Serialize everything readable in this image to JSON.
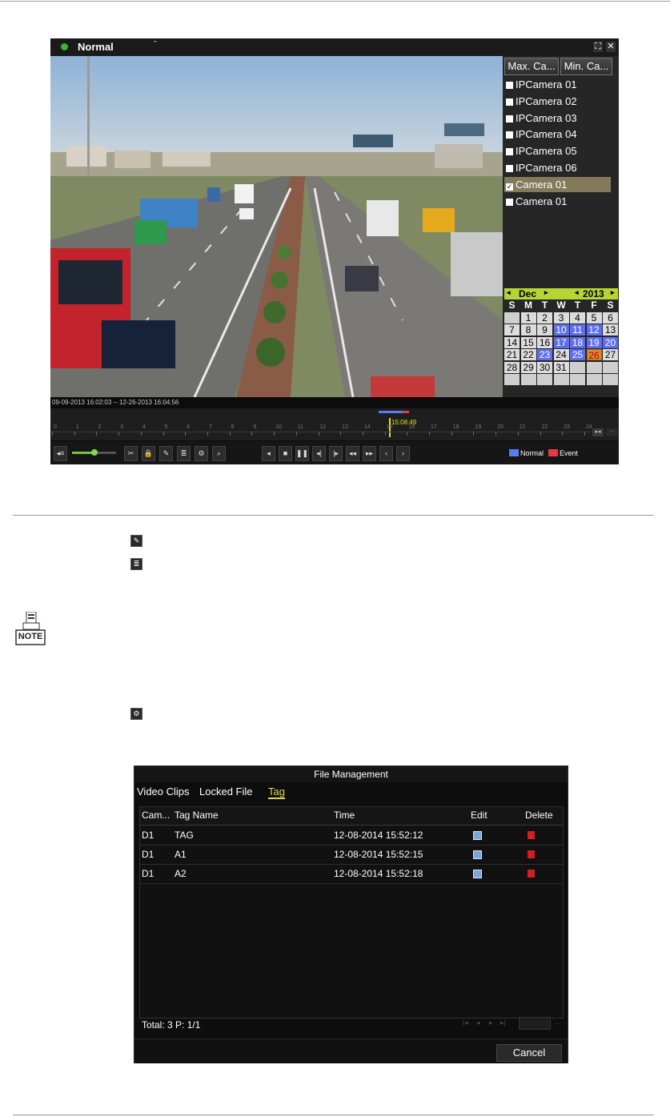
{
  "playback": {
    "mode": "Normal",
    "max_button": "Max. Ca...",
    "min_button": "Min. Ca...",
    "cameras": [
      {
        "label": "IPCamera 01",
        "checked": false
      },
      {
        "label": "IPCamera 02",
        "checked": false
      },
      {
        "label": "IPCamera 03",
        "checked": false
      },
      {
        "label": "IPCamera 04",
        "checked": false
      },
      {
        "label": "IPCamera 05",
        "checked": false
      },
      {
        "label": "IPCamera 06",
        "checked": false
      },
      {
        "label": "Camera 01",
        "checked": true
      },
      {
        "label": "Camera 01",
        "checked": false
      }
    ],
    "calendar": {
      "month": "Dec",
      "year": "2013",
      "weekdays": [
        "S",
        "M",
        "T",
        "W",
        "T",
        "F",
        "S"
      ],
      "days": [
        "",
        "1",
        "2",
        "3",
        "4",
        "5",
        "6",
        "7",
        "8",
        "9",
        "10",
        "11",
        "12",
        "13",
        "14",
        "15",
        "16",
        "17",
        "18",
        "19",
        "20",
        "21",
        "22",
        "23",
        "24",
        "25",
        "26",
        "27",
        "28",
        "29",
        "30",
        "31"
      ],
      "recorded_days": [
        10,
        11,
        12,
        17,
        18,
        19,
        20,
        23,
        25
      ],
      "today": 26
    },
    "time_range": "09-09-2013 16:02:03 -- 12-26-2013 16:04:56",
    "timeline": {
      "current_time": "15:08:49",
      "ticks": [
        "0",
        "1",
        "2",
        "3",
        "4",
        "5",
        "6",
        "7",
        "8",
        "9",
        "10",
        "11",
        "12",
        "13",
        "14",
        "15",
        "16",
        "17",
        "18",
        "19",
        "20",
        "21",
        "22",
        "23",
        "24"
      ]
    },
    "legend": {
      "normal": "Normal",
      "event": "Event",
      "normal_color": "#5a7cf0",
      "event_color": "#e8394a"
    },
    "icons": [
      "volume-icon",
      "clip-icon",
      "lock-file-icon",
      "add-tag-icon",
      "tag-list-icon",
      "settings-icon",
      "zoom-icon",
      "reverse-play-icon",
      "stop-icon",
      "pause-icon",
      "step-back-icon",
      "step-forward-icon",
      "fast-rewind-icon",
      "fast-forward-icon",
      "prev-icon",
      "next-icon"
    ]
  },
  "file_management": {
    "title": "File Management",
    "tabs": [
      "Video Clips",
      "Locked File",
      "Tag"
    ],
    "active_tab": "Tag",
    "columns": [
      "Cam...",
      "Tag Name",
      "Time",
      "Edit",
      "Delete"
    ],
    "rows": [
      {
        "cam": "D1",
        "name": "TAG",
        "time": "12-08-2014 15:52:12"
      },
      {
        "cam": "D1",
        "name": "A1",
        "time": "12-08-2014 15:52:15"
      },
      {
        "cam": "D1",
        "name": "A2",
        "time": "12-08-2014 15:52:18"
      }
    ],
    "total": "Total: 3  P: 1/1",
    "cancel": "Cancel"
  },
  "note_label": "NOTE"
}
